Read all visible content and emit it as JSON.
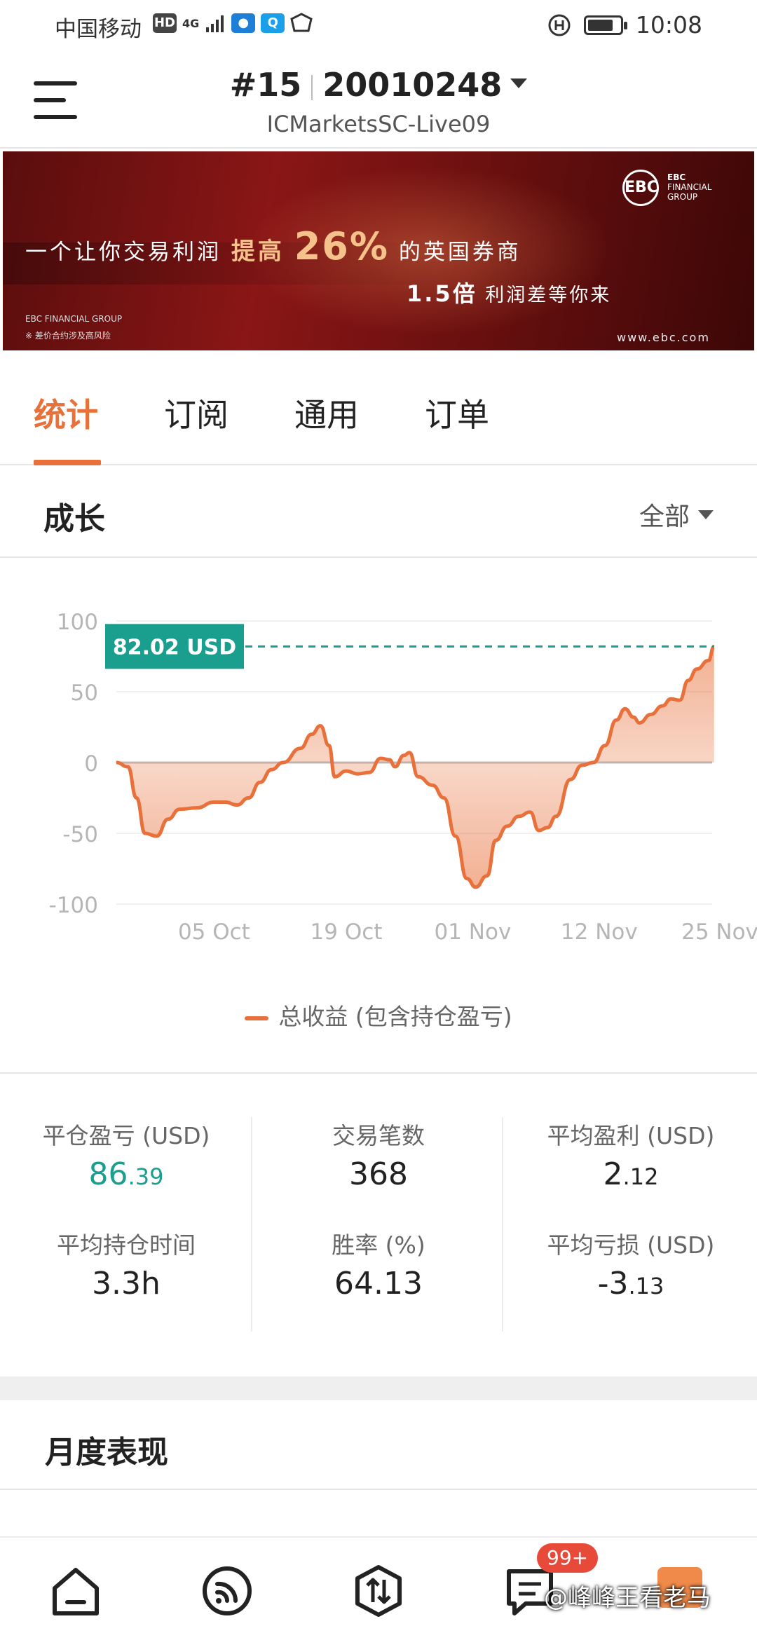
{
  "status_bar": {
    "carrier": "中国移动",
    "hd": "HD",
    "network": "4G",
    "time": "10:08"
  },
  "header": {
    "account_number": "#15",
    "account_id": "20010248",
    "server": "ICMarketsSC-Live09"
  },
  "banner": {
    "line1_a": "一个让你交易利润",
    "line1_hl": "提高",
    "line1_big": "26%",
    "line1_b": "的英国券商",
    "line2_big": "1.5倍",
    "line2_rest": "利润差等你来",
    "logo_text": "EBC",
    "brand_line1": "EBC",
    "brand_line2": "FINANCIAL",
    "brand_line3": "GROUP",
    "corner_brand": "EBC FINANCIAL GROUP",
    "corner_note": "※ 差价合约涉及高风险",
    "url": "www.ebc.com"
  },
  "tabs": [
    "统计",
    "订阅",
    "通用",
    "订单"
  ],
  "growth": {
    "title": "成长",
    "filter_label": "全部"
  },
  "chart_data": {
    "type": "area",
    "ylim": [
      -100,
      100
    ],
    "yticks": [
      100,
      50,
      0,
      -50,
      -100
    ],
    "xtick_labels": [
      "05 Oct",
      "19 Oct",
      "01 Nov",
      "12 Nov",
      "25 Nov"
    ],
    "current_value_label": "82.02 USD",
    "current_value": 82.02,
    "legend": "总收益 (包含持仓盈亏)",
    "series": [
      {
        "name": "总收益 (包含持仓盈亏)",
        "points": [
          [
            0.0,
            0
          ],
          [
            0.02,
            -3
          ],
          [
            0.035,
            -25
          ],
          [
            0.05,
            -50
          ],
          [
            0.07,
            -52
          ],
          [
            0.09,
            -40
          ],
          [
            0.11,
            -33
          ],
          [
            0.14,
            -32
          ],
          [
            0.17,
            -28
          ],
          [
            0.19,
            -28
          ],
          [
            0.21,
            -30
          ],
          [
            0.23,
            -25
          ],
          [
            0.25,
            -14
          ],
          [
            0.27,
            -5
          ],
          [
            0.29,
            0
          ],
          [
            0.32,
            10
          ],
          [
            0.34,
            20
          ],
          [
            0.355,
            26
          ],
          [
            0.37,
            12
          ],
          [
            0.38,
            -10
          ],
          [
            0.4,
            -6
          ],
          [
            0.42,
            -8
          ],
          [
            0.44,
            -7
          ],
          [
            0.46,
            3
          ],
          [
            0.475,
            2
          ],
          [
            0.485,
            -3
          ],
          [
            0.5,
            5
          ],
          [
            0.51,
            7
          ],
          [
            0.525,
            -10
          ],
          [
            0.55,
            -16
          ],
          [
            0.57,
            -25
          ],
          [
            0.59,
            -52
          ],
          [
            0.61,
            -82
          ],
          [
            0.625,
            -88
          ],
          [
            0.645,
            -80
          ],
          [
            0.66,
            -55
          ],
          [
            0.68,
            -45
          ],
          [
            0.7,
            -38
          ],
          [
            0.72,
            -35
          ],
          [
            0.735,
            -48
          ],
          [
            0.75,
            -46
          ],
          [
            0.765,
            -38
          ],
          [
            0.79,
            -12
          ],
          [
            0.81,
            -2
          ],
          [
            0.83,
            0
          ],
          [
            0.85,
            12
          ],
          [
            0.87,
            30
          ],
          [
            0.885,
            38
          ],
          [
            0.9,
            32
          ],
          [
            0.91,
            28
          ],
          [
            0.93,
            34
          ],
          [
            0.95,
            40
          ],
          [
            0.965,
            45
          ],
          [
            0.98,
            44
          ],
          [
            0.995,
            58
          ],
          [
            1.01,
            66
          ],
          [
            1.03,
            72
          ],
          [
            1.04,
            82.02
          ]
        ]
      }
    ]
  },
  "stats": [
    {
      "label": "平仓盈亏 (USD)",
      "int": "86",
      "dec": ".39"
    },
    {
      "label": "交易笔数",
      "int": "368",
      "dec": ""
    },
    {
      "label": "平均盈利 (USD)",
      "int": "2",
      "dec": ".12"
    },
    {
      "label": "平均持仓时间",
      "int": "3.3h",
      "dec": ""
    },
    {
      "label": "胜率 (%)",
      "int": "64.13",
      "dec": ""
    },
    {
      "label": "平均亏损 (USD)",
      "int": "-3",
      "dec": ".13"
    }
  ],
  "monthly": {
    "title": "月度表现"
  },
  "bottom_nav": {
    "items": [
      "home-icon",
      "feed-icon",
      "trade-icon",
      "messages-icon"
    ],
    "badge": "99+",
    "watermark": "@峰峰王看老马"
  },
  "colors": {
    "accent": "#e8703a",
    "positive": "#1a9e8e",
    "badge": "#e84a3a"
  }
}
